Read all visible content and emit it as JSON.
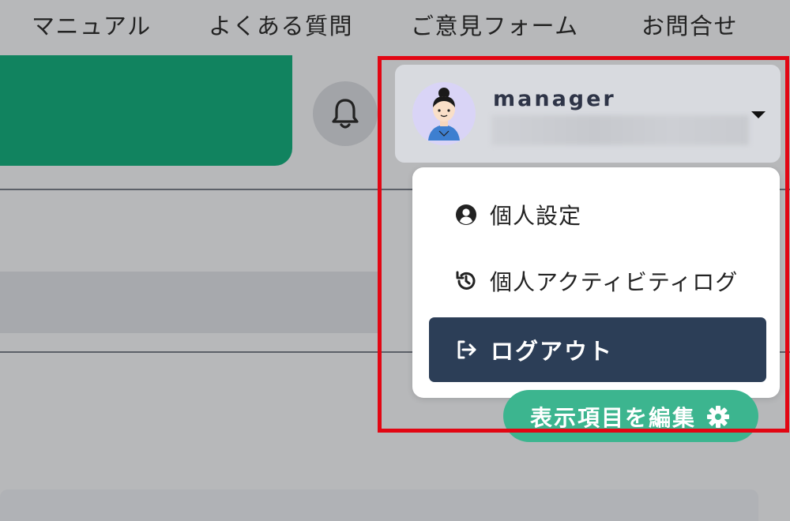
{
  "topnav": {
    "items": [
      {
        "label": "マニュアル"
      },
      {
        "label": "よくある質問"
      },
      {
        "label": "ご意見フォーム"
      },
      {
        "label": "お問合せ"
      }
    ]
  },
  "header": {
    "notification_icon": "bell-icon"
  },
  "user_menu": {
    "username": "manager",
    "avatar_icon": "user-avatar",
    "caret_icon": "caret-down-icon"
  },
  "dropdown": {
    "items": [
      {
        "label": "個人設定",
        "icon": "user-circle-icon"
      },
      {
        "label": "個人アクティビティログ",
        "icon": "history-icon"
      },
      {
        "label": "ログアウト",
        "icon": "sign-out-icon"
      }
    ]
  },
  "toolbar": {
    "edit_columns_label": "表示項目を編集",
    "edit_columns_icon": "gear-icon"
  },
  "colors": {
    "brand_green": "#11835f",
    "button_green": "#3cb58f",
    "logout_bg": "#2c3e57",
    "highlight_red": "#e20613"
  }
}
